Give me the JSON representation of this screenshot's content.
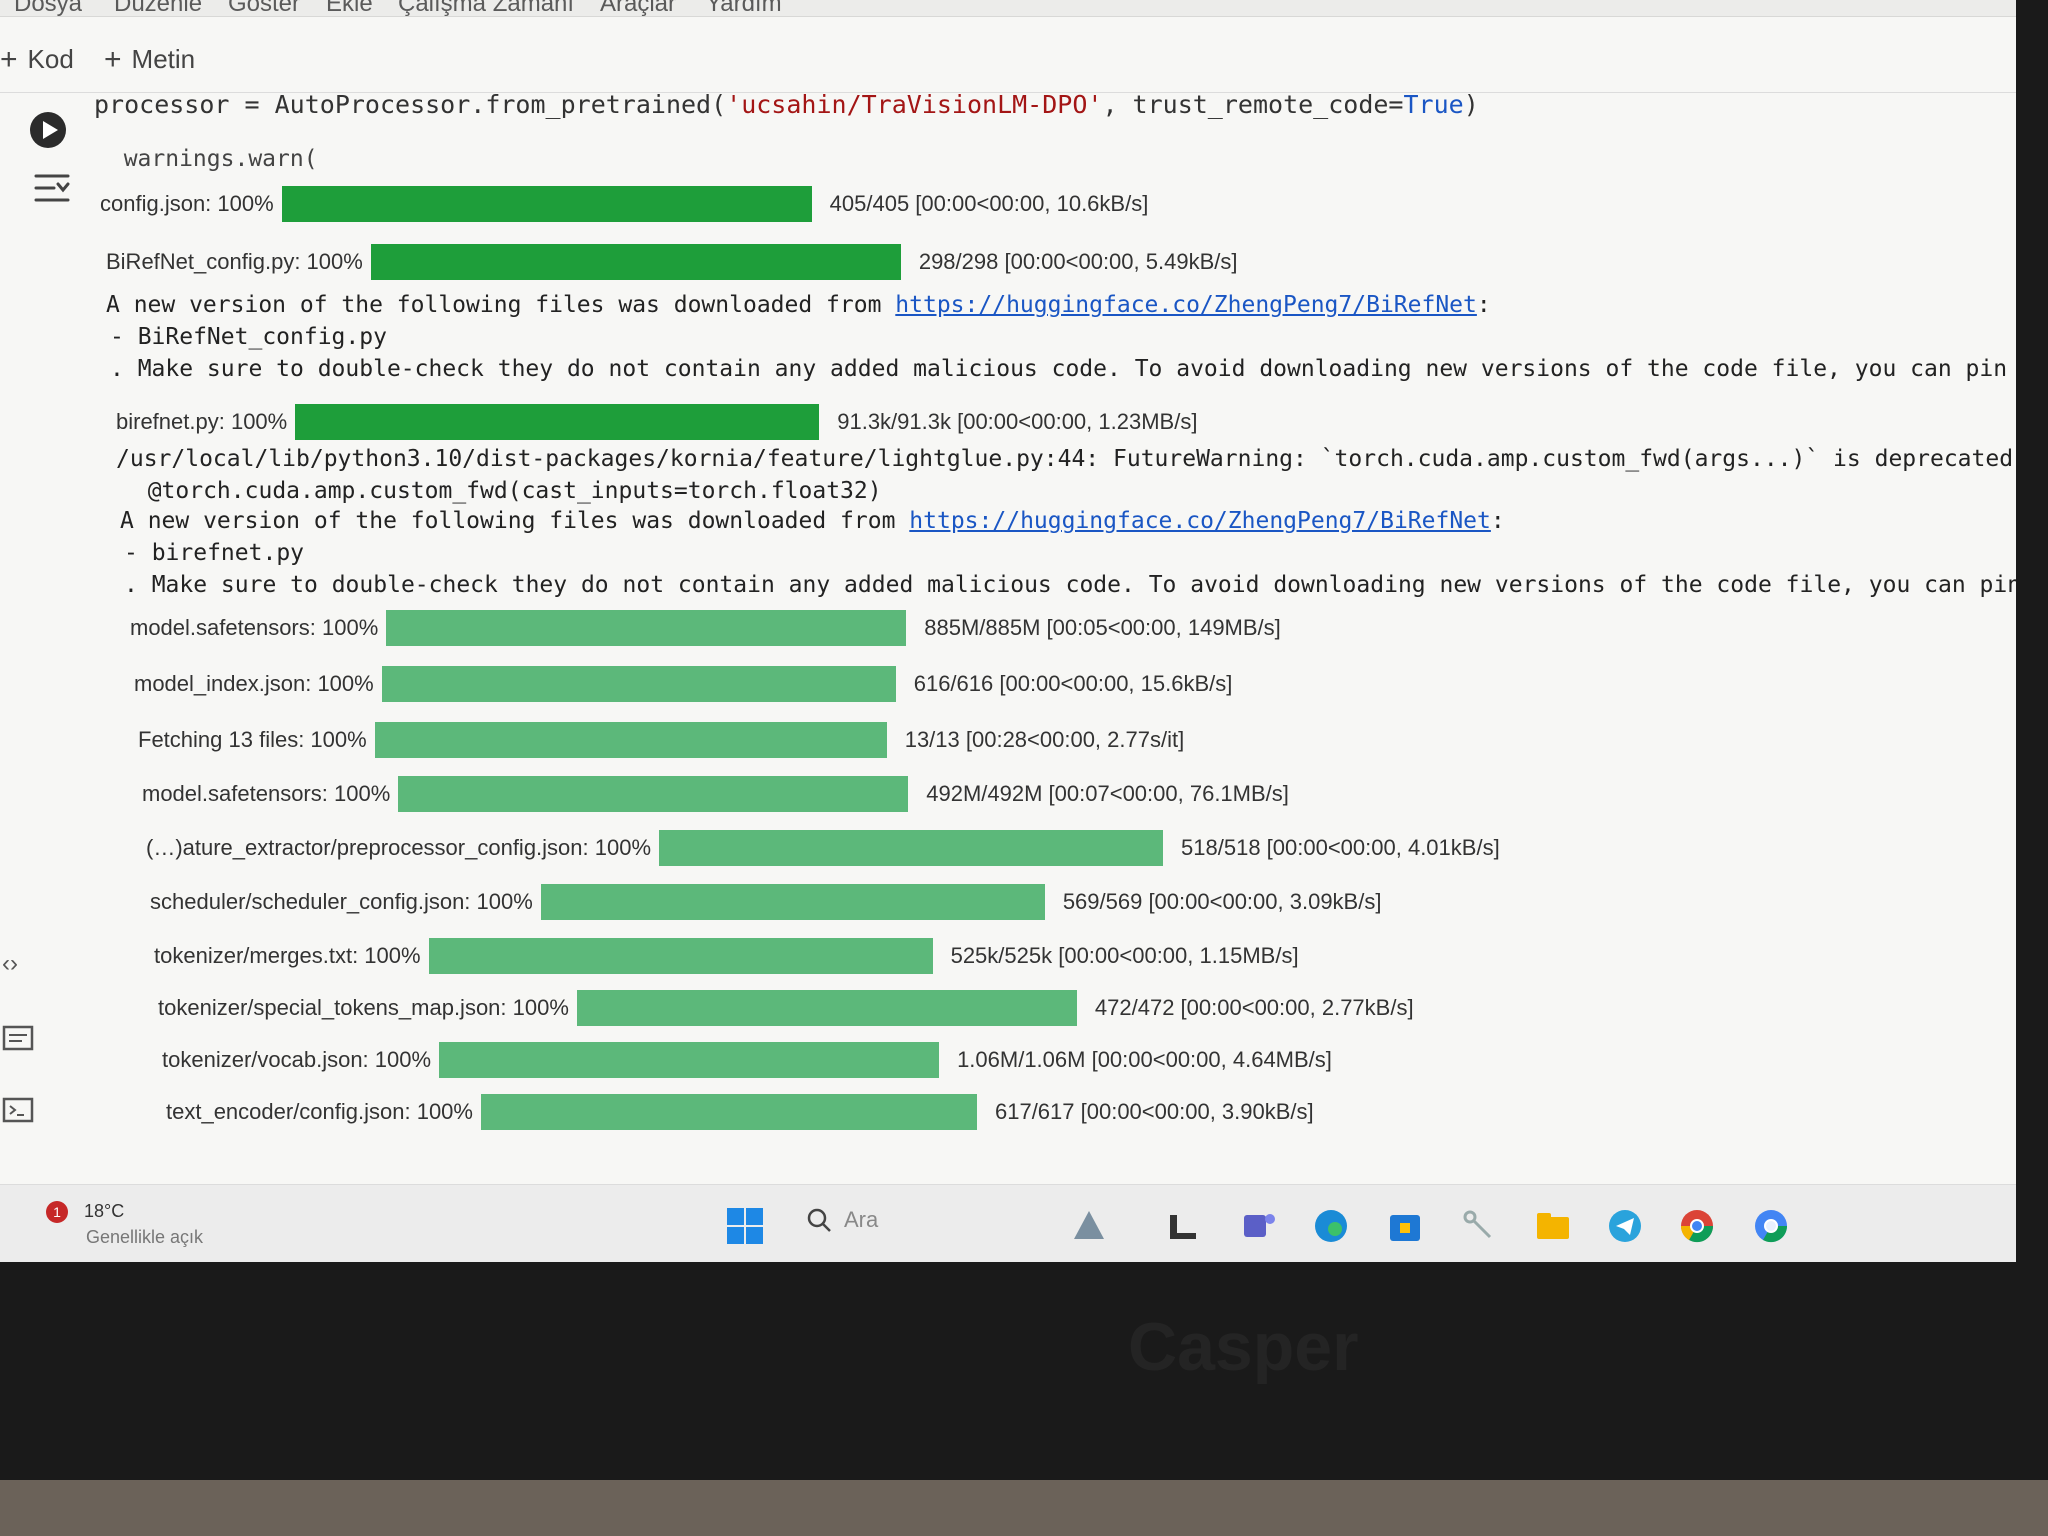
{
  "menu": [
    "Dosya",
    "Düzenle",
    "Göster",
    "Ekle",
    "Çalışma Zamanı",
    "Araçlar",
    "Yardım"
  ],
  "toolbar": {
    "add_code": "Kod",
    "add_text": "Metin"
  },
  "cell": {
    "code_prefix": "processor = AutoProcessor.from_pretrained(",
    "code_arg": "'ucsahin/TraVisionLM-DPO'",
    "code_mid": ", trust_remote_code=",
    "code_true": "True",
    "code_end": ")"
  },
  "output": {
    "warn_line": "  warnings.warn(",
    "notice1_prefix": "A new version of the following files was downloaded from ",
    "notice_url": "https://huggingface.co/ZhengPeng7/BiRefNet",
    "notice_suffix": ":",
    "notice1_file": "- BiRefNet_config.py",
    "notice_body": ". Make sure to double-check they do not contain any added malicious code. To avoid downloading new versions of the code file, you can pin a re",
    "future_warning": "/usr/local/lib/python3.10/dist-packages/kornia/feature/lightglue.py:44: FutureWarning: `torch.cuda.amp.custom_fwd(args...)` is deprecated. Ple",
    "decorator_line": "  @torch.cuda.amp.custom_fwd(cast_inputs=torch.float32)",
    "notice2_file": "- birefnet.py",
    "notice2_body": ". Make sure to double-check they do not contain any added malicious code. To avoid downloading new versions of the code file, you can pin a rev"
  },
  "progress": [
    {
      "label": "config.json:",
      "pct_text": "100%",
      "pct": 1.0,
      "stats": "405/405 [00:00<00:00, 10.6kB/s]"
    },
    {
      "label": "BiRefNet_config.py:",
      "pct_text": "100%",
      "pct": 1.0,
      "stats": "298/298 [00:00<00:00, 5.49kB/s]"
    },
    {
      "label": "birefnet.py:",
      "pct_text": "100%",
      "pct": 1.0,
      "stats": "91.3k/91.3k [00:00<00:00, 1.23MB/s]"
    },
    {
      "label": "model.safetensors:",
      "pct_text": "100%",
      "pct": 1.0,
      "stats": "885M/885M [00:05<00:00, 149MB/s]"
    },
    {
      "label": "model_index.json:",
      "pct_text": "100%",
      "pct": 1.0,
      "stats": "616/616 [00:00<00:00, 15.6kB/s]"
    },
    {
      "label": "Fetching 13 files:",
      "pct_text": "100%",
      "pct": 1.0,
      "stats": "13/13 [00:28<00:00, 2.77s/it]"
    },
    {
      "label": "model.safetensors:",
      "pct_text": "100%",
      "pct": 1.0,
      "stats": "492M/492M [00:07<00:00, 76.1MB/s]"
    },
    {
      "label": "(…)ature_extractor/preprocessor_config.json:",
      "pct_text": "100%",
      "pct": 1.0,
      "stats": "518/518 [00:00<00:00, 4.01kB/s]"
    },
    {
      "label": "scheduler/scheduler_config.json:",
      "pct_text": "100%",
      "pct": 1.0,
      "stats": "569/569 [00:00<00:00, 3.09kB/s]"
    },
    {
      "label": "tokenizer/merges.txt:",
      "pct_text": "100%",
      "pct": 1.0,
      "stats": "525k/525k [00:00<00:00, 1.15MB/s]"
    },
    {
      "label": "tokenizer/special_tokens_map.json:",
      "pct_text": "100%",
      "pct": 1.0,
      "stats": "472/472 [00:00<00:00, 2.77kB/s]"
    },
    {
      "label": "tokenizer/vocab.json:",
      "pct_text": "100%",
      "pct": 1.0,
      "stats": "1.06M/1.06M [00:00<00:00, 4.64MB/s]"
    },
    {
      "label": "text_encoder/config.json:",
      "pct_text": "100%",
      "pct": 1.0,
      "stats": "617/617 [00:00<00:00, 3.90kB/s]"
    }
  ],
  "colors": {
    "bar_strong": "#1e9e3a",
    "bar_soft": "#5cb87a"
  },
  "taskbar": {
    "weather_badge": "1",
    "temperature": "18°C",
    "weather_desc": "Genellikle açık",
    "search_placeholder": "Ara",
    "icons": [
      "start-icon",
      "search-icon",
      "widgets-icon",
      "file-manager-icon",
      "teams-icon",
      "edge-icon",
      "store-icon",
      "snipping-tool-icon",
      "folder-icon",
      "telegram-icon",
      "chrome-icon",
      "chrome-profile-icon"
    ]
  },
  "bezel": {
    "brand": "Casper"
  }
}
